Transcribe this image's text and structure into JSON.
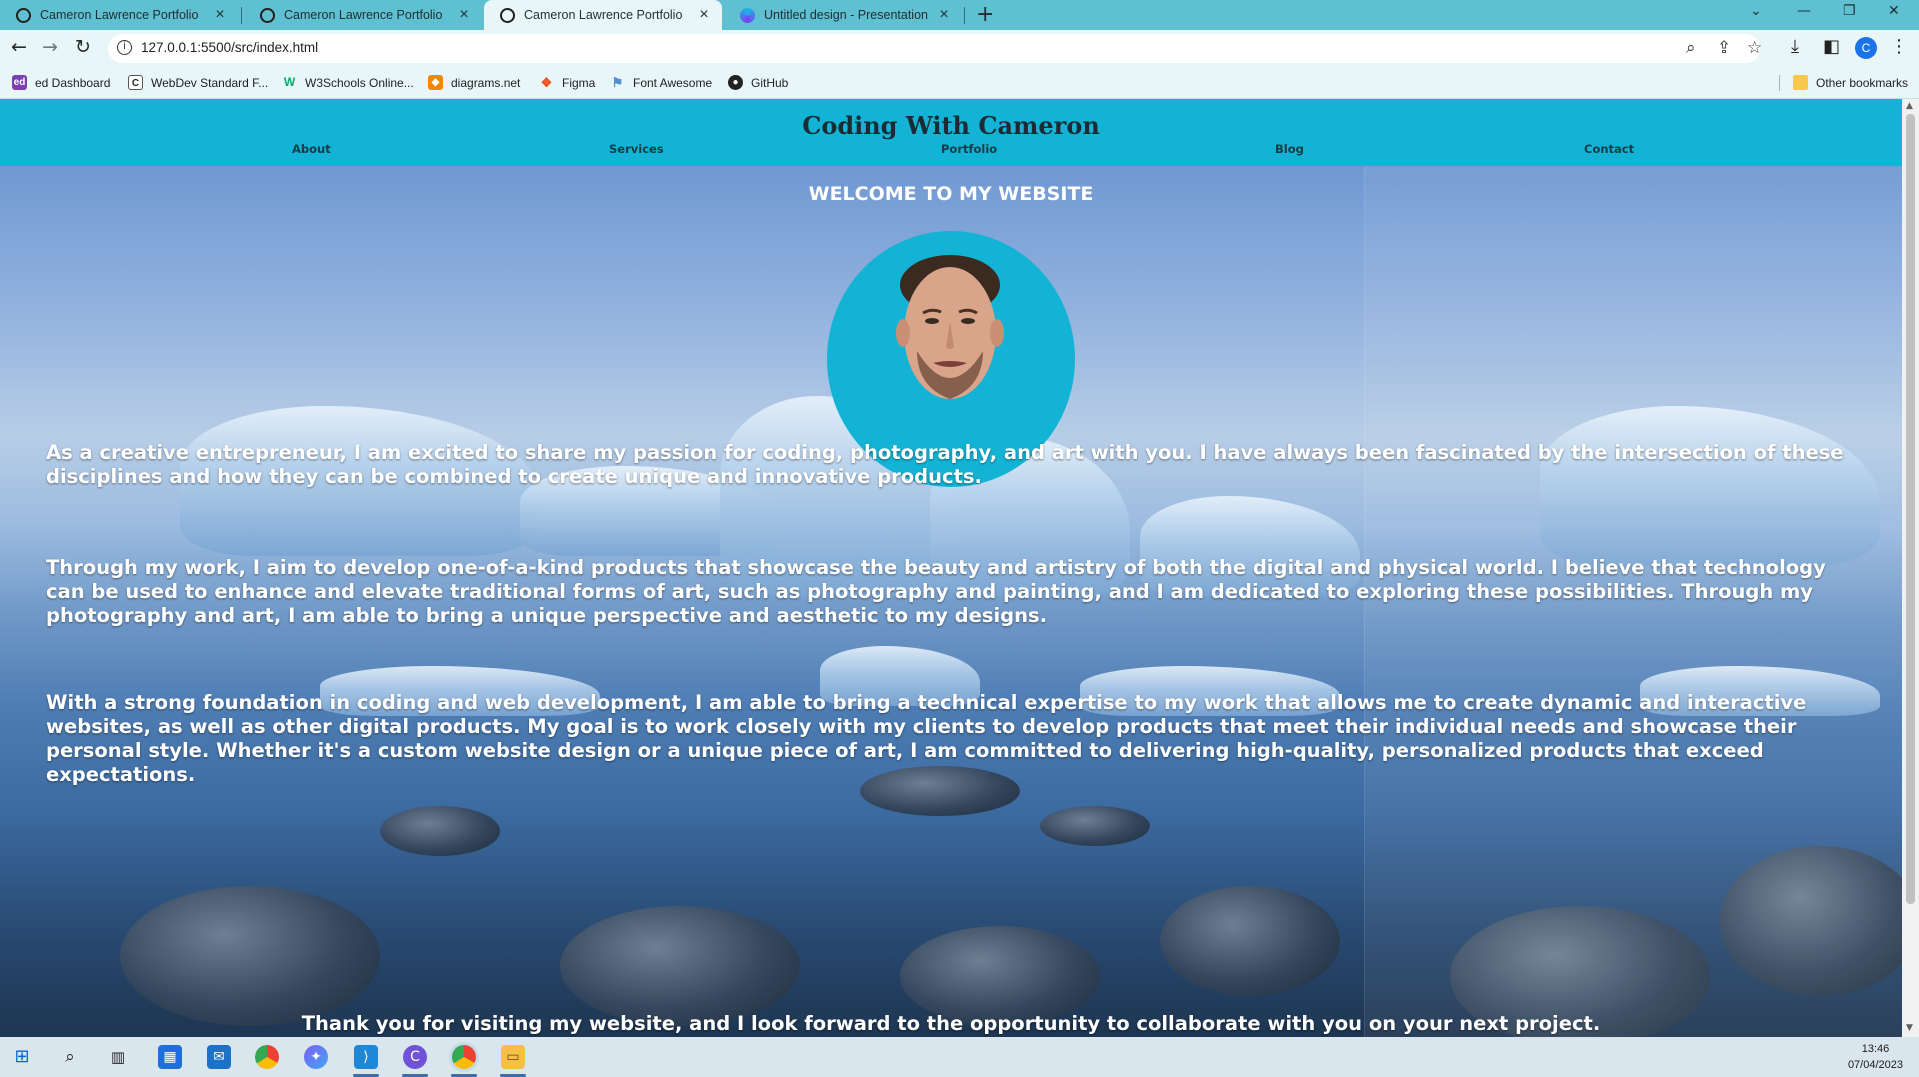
{
  "browser": {
    "tabs": [
      {
        "label": "Cameron Lawrence Portfolio",
        "active": false,
        "icon": "github-icon"
      },
      {
        "label": "Cameron Lawrence Portfolio",
        "active": false,
        "icon": "github-icon"
      },
      {
        "label": "Cameron Lawrence Portfolio",
        "active": true,
        "icon": "github-icon"
      },
      {
        "label": "Untitled design - Presentation",
        "active": false,
        "icon": "canva-icon"
      }
    ],
    "new_tab": "+",
    "url": "127.0.0.1:5500/src/index.html",
    "profile_initial": "C",
    "bookmarks": [
      {
        "label": "ed Dashboard",
        "icon": "ed-icon",
        "color": "#7b3fb0"
      },
      {
        "label": "WebDev Standard F...",
        "icon": "webdev-icon",
        "color": "#222222"
      },
      {
        "label": "W3Schools Online...",
        "icon": "w3schools-icon",
        "color": "#04aa6d"
      },
      {
        "label": "diagrams.net",
        "icon": "diagrams-icon",
        "color": "#f08705"
      },
      {
        "label": "Figma",
        "icon": "figma-icon",
        "color": "#f24e1e"
      },
      {
        "label": "Font Awesome",
        "icon": "flag-icon",
        "color": "#528dd7"
      },
      {
        "label": "GitHub",
        "icon": "github-icon",
        "color": "#222222"
      }
    ],
    "other_bookmarks": "Other bookmarks"
  },
  "site": {
    "title": "Coding With Cameron",
    "nav": [
      "About",
      "Services",
      "Portfolio",
      "Blog",
      "Contact"
    ],
    "welcome": "WELCOME TO MY WEBSITE",
    "paragraphs": [
      "As a creative entrepreneur, I am excited to share my passion for coding, photography, and art with you. I have always been fascinated by the intersection of these disciplines and how they can be combined to create unique and innovative products.",
      "Through my work, I aim to develop one-of-a-kind products that showcase the beauty and artistry of both the digital and physical world. I believe that technology can be used to enhance and elevate traditional forms of art, such as photography and painting, and I am dedicated to exploring these possibilities. Through my photography and art, I am able to bring a unique perspective and aesthetic to my designs.",
      "With a strong foundation in coding and web development, I am able to bring a technical expertise to my work that allows me to create dynamic and interactive websites, as well as other digital products. My goal is to work closely with my clients to develop products that meet their individual needs and showcase their personal style. Whether it's a custom website design or a unique piece of art, I am committed to delivering high-quality, personalized products that exceed expectations."
    ],
    "closing": "Thank you for visiting my website, and I look forward to the opportunity to collaborate with you on your next project.",
    "colors": {
      "header": "#12b3d4",
      "avatar_ring": "#12b3d4",
      "text": "#ffffff"
    }
  },
  "taskbar": {
    "time": "13:46",
    "date": "07/04/2023"
  }
}
